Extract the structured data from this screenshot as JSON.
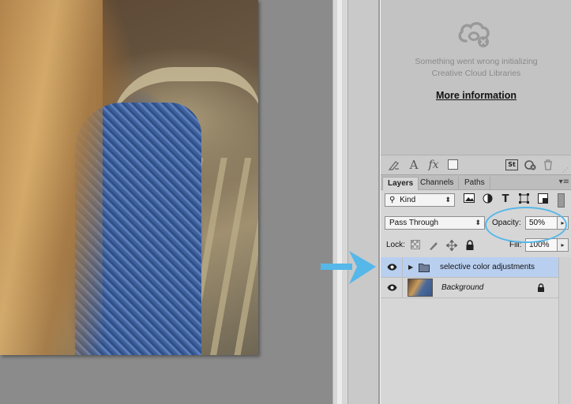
{
  "libraries": {
    "error_line1": "Something went wrong initializing",
    "error_line2": "Creative Cloud Libraries",
    "more_info_link": "More information"
  },
  "lib_toolbar": {
    "icons": [
      "brush-icon",
      "text-A-icon",
      "fx-icon",
      "color-swatch-icon",
      "stock-icon",
      "sync-icon",
      "trash-icon"
    ],
    "text_icon_glyph": "A",
    "fx_glyph": "fx",
    "stock_glyph": "St"
  },
  "tabs": [
    {
      "label": "Layers",
      "active": true
    },
    {
      "label": "Channels",
      "active": false
    },
    {
      "label": "Paths",
      "active": false
    }
  ],
  "filter": {
    "kind_label": "Kind",
    "type_glyph": "T"
  },
  "blend": {
    "mode": "Pass Through",
    "opacity_label": "Opacity:",
    "opacity_value": "50%"
  },
  "lock": {
    "label": "Lock:",
    "fill_label": "Fill:",
    "fill_value": "100%"
  },
  "layers": [
    {
      "name": "selective color adjustments",
      "type": "group",
      "visible": true,
      "selected": true
    },
    {
      "name": "Background",
      "type": "image",
      "visible": true,
      "selected": false,
      "locked": true
    }
  ],
  "colors": {
    "selected_layer": "#b9cff0",
    "annotation": "#56b7e9"
  }
}
